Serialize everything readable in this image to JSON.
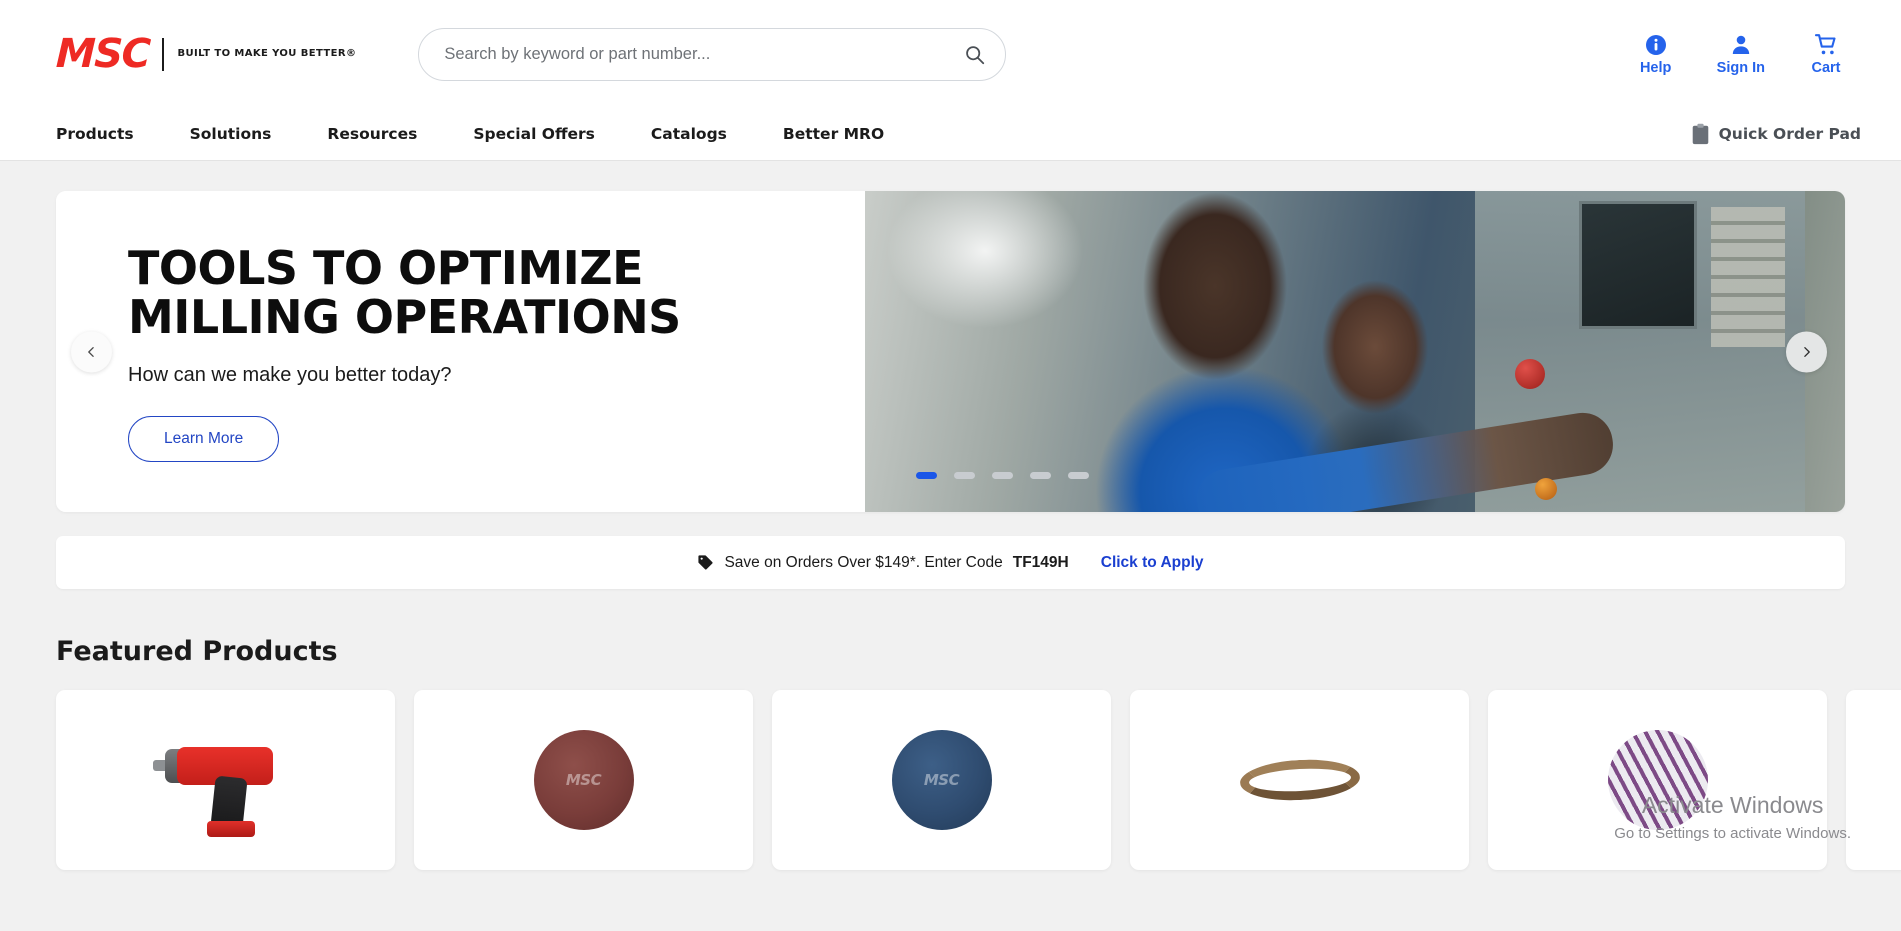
{
  "header": {
    "logo": {
      "wordmark": "MSC",
      "tagline": "BUILT\nTO MAKE\nYOU BETTER®"
    },
    "search": {
      "placeholder": "Search by keyword or part number...",
      "value": "",
      "icon": "search-icon"
    },
    "utilities": [
      {
        "label": "Help",
        "icon": "info-circle-icon"
      },
      {
        "label": "Sign In",
        "icon": "person-icon"
      },
      {
        "label": "Cart",
        "icon": "shopping-cart-icon"
      }
    ],
    "nav": [
      {
        "label": "Products"
      },
      {
        "label": "Solutions"
      },
      {
        "label": "Resources"
      },
      {
        "label": "Special Offers"
      },
      {
        "label": "Catalogs"
      },
      {
        "label": "Better MRO"
      }
    ],
    "quick_order": {
      "label": "Quick Order Pad",
      "icon": "clipboard-icon"
    },
    "accent_color": "#2563eb",
    "brand_color": "#ee2a24"
  },
  "hero": {
    "title": "TOOLS TO OPTIMIZE\nMILLING OPERATIONS",
    "subtitle": "How can we make you better today?",
    "cta_label": "Learn More",
    "prev_icon": "chevron-left-icon",
    "next_icon": "chevron-right-icon",
    "slides_total": 5,
    "active_slide": 1,
    "active_dot_color": "#1a56e8",
    "inactive_dot_color": "#c8ccd0"
  },
  "promo": {
    "icon": "tag-icon",
    "text": "Save on Orders Over $149*. Enter Code ",
    "code": "TF149H",
    "link_label": "Click to Apply",
    "link_color": "#1a3fd0"
  },
  "featured": {
    "title": "Featured Products",
    "products": [
      {
        "name": "milwaukee-impact-wrench",
        "art": "wrench"
      },
      {
        "name": "maroon-surface-conditioning-disc",
        "art": "disc-maroon",
        "logo": "MSC"
      },
      {
        "name": "blue-surface-conditioning-disc",
        "art": "disc-blue",
        "logo": "MSC"
      },
      {
        "name": "abrasive-sanding-belt",
        "art": "belt"
      },
      {
        "name": "purple-abrasive-disc",
        "art": "disc-purple"
      },
      {
        "name": "next-product",
        "art": "partial"
      }
    ]
  },
  "watermark": {
    "title": "Activate Windows",
    "subtitle": "Go to Settings to activate Windows."
  }
}
